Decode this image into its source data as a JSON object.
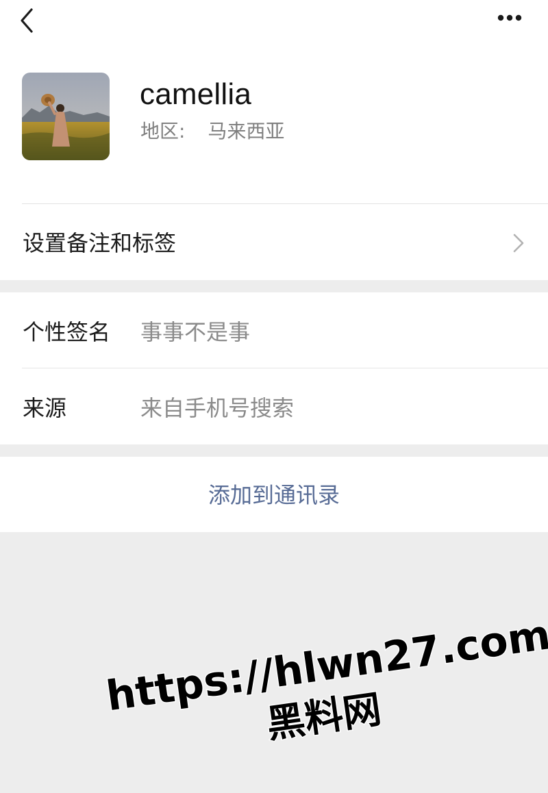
{
  "header": {
    "back_icon": "chevron-left-icon",
    "more_icon": "more-horizontal-icon",
    "profile": {
      "nickname": "camellia",
      "region_label": "地区:",
      "region_value": "马来西亚",
      "avatar": "photo of a woman in a field holding a hat"
    }
  },
  "remark": {
    "label": "设置备注和标签",
    "icon": "chevron-right-icon"
  },
  "info": {
    "rows": [
      {
        "label": "个性签名",
        "value": "事事不是事"
      },
      {
        "label": "来源",
        "value": "来自手机号搜索"
      }
    ]
  },
  "actions": {
    "add_contact_label": "添加到通讯录"
  },
  "colors": {
    "link_blue": "#576b95",
    "page_background": "#ededed",
    "secondary_text": "#8a8a8a"
  },
  "watermark": {
    "url": "https://hlwn27.com",
    "name": "黑料网"
  }
}
